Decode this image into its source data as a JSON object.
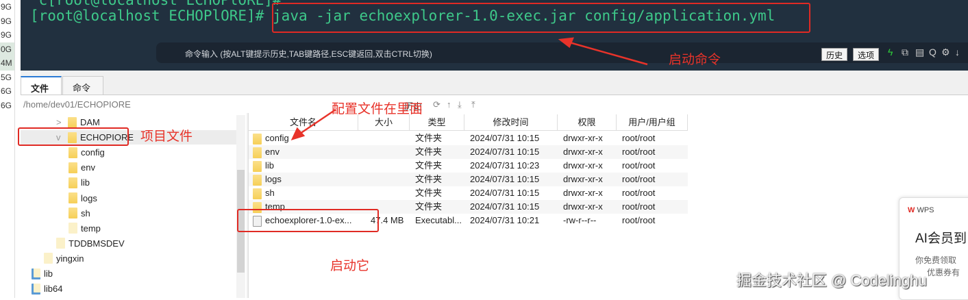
{
  "left_strip": [
    "9G",
    "9G",
    "9G",
    "0G",
    "4M",
    "5G",
    "6G",
    "6G"
  ],
  "terminal": {
    "prev_line": " c[root@localhost ECHOPlORE]#",
    "prompt": "[root@localhost ECHOPlORE]#",
    "command": "java -jar echoexplorer-1.0-exec.jar config/application.yml",
    "input_hint": "命令输入 (按ALT键提示历史,TAB键路径,ESC键返回,双击CTRL切换)",
    "history_btn": "历史",
    "options_btn": "选项"
  },
  "tabs": [
    "文件",
    "命令"
  ],
  "path": "/home/dev01/ECHOPIORE",
  "toolbar_history": "历史",
  "tree": [
    {
      "name": "DAM",
      "indent": 2,
      "expand": ">"
    },
    {
      "name": "ECHOPIORE",
      "indent": 2,
      "expand": "v",
      "selected": true
    },
    {
      "name": "config",
      "indent": 3
    },
    {
      "name": "env",
      "indent": 3
    },
    {
      "name": "lib",
      "indent": 3
    },
    {
      "name": "logs",
      "indent": 3
    },
    {
      "name": "sh",
      "indent": 3
    },
    {
      "name": "temp",
      "indent": 3,
      "pale": true
    },
    {
      "name": "TDDBMSDEV",
      "indent": 2,
      "pale": true
    },
    {
      "name": "yingxin",
      "indent": 1,
      "pale": true
    },
    {
      "name": "lib",
      "indent": 0,
      "link": true
    },
    {
      "name": "lib64",
      "indent": 0,
      "link": true
    }
  ],
  "file_headers": [
    "文件名",
    "大小",
    "类型",
    "修改时间",
    "权限",
    "用户/用户组"
  ],
  "files": [
    {
      "name": "config",
      "size": "",
      "type": "文件夹",
      "mtime": "2024/07/31 10:15",
      "perm": "drwxr-xr-x",
      "owner": "root/root"
    },
    {
      "name": "env",
      "size": "",
      "type": "文件夹",
      "mtime": "2024/07/31 10:15",
      "perm": "drwxr-xr-x",
      "owner": "root/root"
    },
    {
      "name": "lib",
      "size": "",
      "type": "文件夹",
      "mtime": "2024/07/31 10:23",
      "perm": "drwxr-xr-x",
      "owner": "root/root"
    },
    {
      "name": "logs",
      "size": "",
      "type": "文件夹",
      "mtime": "2024/07/31 10:15",
      "perm": "drwxr-xr-x",
      "owner": "root/root"
    },
    {
      "name": "sh",
      "size": "",
      "type": "文件夹",
      "mtime": "2024/07/31 10:15",
      "perm": "drwxr-xr-x",
      "owner": "root/root"
    },
    {
      "name": "temp",
      "size": "",
      "type": "文件夹",
      "mtime": "2024/07/31 10:15",
      "perm": "drwxr-xr-x",
      "owner": "root/root"
    },
    {
      "name": "echoexplorer-1.0-ex...",
      "size": "47.4 MB",
      "type": "Executabl...",
      "mtime": "2024/07/31 10:21",
      "perm": "-rw-r--r--",
      "owner": "root/root",
      "file": true
    }
  ],
  "annotations": {
    "start_cmd": "启动命令",
    "project_files": "项目文件",
    "config_inside": "配置文件在里面",
    "start_it": "启动它"
  },
  "wps": {
    "brand": "WPS",
    "title": "AI会员到",
    "sub": "你免费领取",
    "sub2": "优惠券有"
  },
  "watermark": "掘金技术社区 @ Codelinghu"
}
